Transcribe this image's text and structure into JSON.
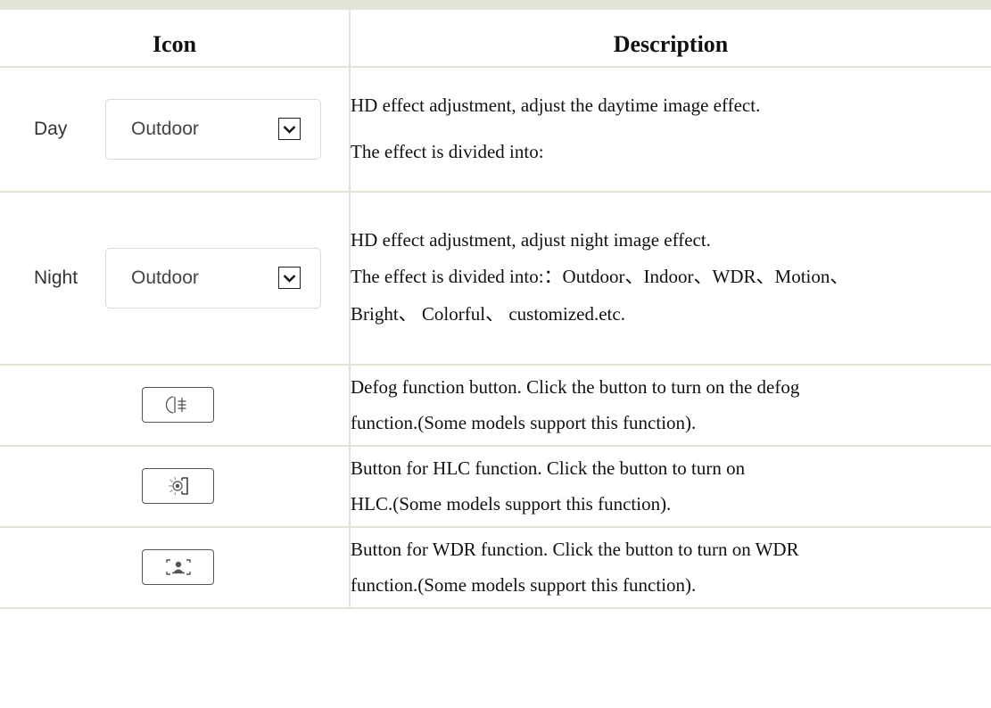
{
  "table": {
    "header": {
      "icon_col": "Icon",
      "desc_col": "Description"
    },
    "day_row": {
      "label": "Day",
      "select_value": "Outdoor",
      "desc_lines": [
        "HD effect adjustment, adjust the daytime image effect.",
        "The effect is divided into:"
      ]
    },
    "night_row": {
      "label": "Night",
      "select_value": "Outdoor",
      "desc_lines": [
        "HD effect adjustment, adjust night image effect.",
        "The effect is divided into:：Outdoor、Indoor、WDR、Motion、",
        "Bright、 Colorful、 customized.etc."
      ]
    },
    "defog_row": {
      "icon": "defog-icon",
      "desc_lines": [
        "Defog function button. Click the button to turn on the defog",
        "function.(Some models support this function)."
      ]
    },
    "hlc_row": {
      "icon": "hlc-icon",
      "desc_lines": [
        "Button for HLC function. Click the button to turn on",
        "HLC.(Some models support this function)."
      ]
    },
    "wdr_row": {
      "icon": "wdr-icon",
      "desc_lines": [
        "Button for WDR function. Click the button to turn on WDR",
        "function.(Some models support this function)."
      ]
    }
  }
}
